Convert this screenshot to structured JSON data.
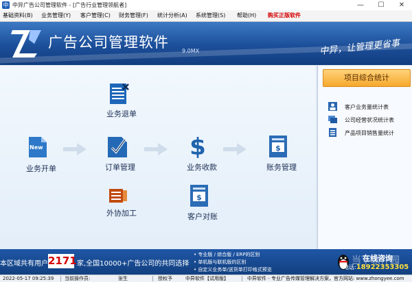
{
  "window": {
    "title": "中异广告公司管理软件 - [广告行业管理领航者]",
    "controls": [
      "—",
      "☐",
      "✕"
    ]
  },
  "menu": [
    {
      "label": "基础资料(B)"
    },
    {
      "label": "业务管理(Y)"
    },
    {
      "label": "客户管理(C)"
    },
    {
      "label": "财务管理(F)"
    },
    {
      "label": "统计分析(A)"
    },
    {
      "label": "系统管理(S)"
    },
    {
      "label": "帮助(H)"
    },
    {
      "label": "购买正版软件"
    }
  ],
  "header": {
    "app_title": "广告公司管理软件",
    "version": "9.0MX",
    "slogan": "中异，让管理更省事"
  },
  "workflow": {
    "nodes": {
      "business_return": "业务退单",
      "business_open": "业务开单",
      "order_management": "订单管理",
      "business_receipt": "业务收款",
      "account_management": "账务管理",
      "outsourcing": "外协加工",
      "customer_reconcile": "客户对账"
    },
    "new_badge": "New"
  },
  "right_panel": {
    "stats_button": "项目综合统计",
    "items": [
      {
        "label": "客户业务量统计表"
      },
      {
        "label": "公司经营状况统计表"
      },
      {
        "label": "产品项目销售量统计"
      }
    ]
  },
  "bottom_banner": {
    "text_before": "本区域共有用户",
    "user_count": "2171",
    "text_after": "家,全国10000+广告公司的共同选择",
    "promos": [
      "专业版 / 综合版 / ERP的区别",
      "单机版与联机版的区别",
      "自定义业务单/送货单打印格式预览"
    ],
    "consult": "在线咨询",
    "phone_label": "电话:",
    "phone": "18922353305",
    "watermark": "当下软件园"
  },
  "status_bar": {
    "datetime": "2022-05-17 09:25:39",
    "operator_label": "当前操作员:",
    "operator": "张生",
    "auth_label": "授权予",
    "edition": "中异软件【试用版】",
    "footer": "中异软件 - 专业广告传媒管理解决方案，官方网站: www.zhongyee.com"
  },
  "colors": {
    "banner_blue": "#1c4f9a",
    "accent_orange": "#f6a92c",
    "highlight_red": "#d40000"
  }
}
